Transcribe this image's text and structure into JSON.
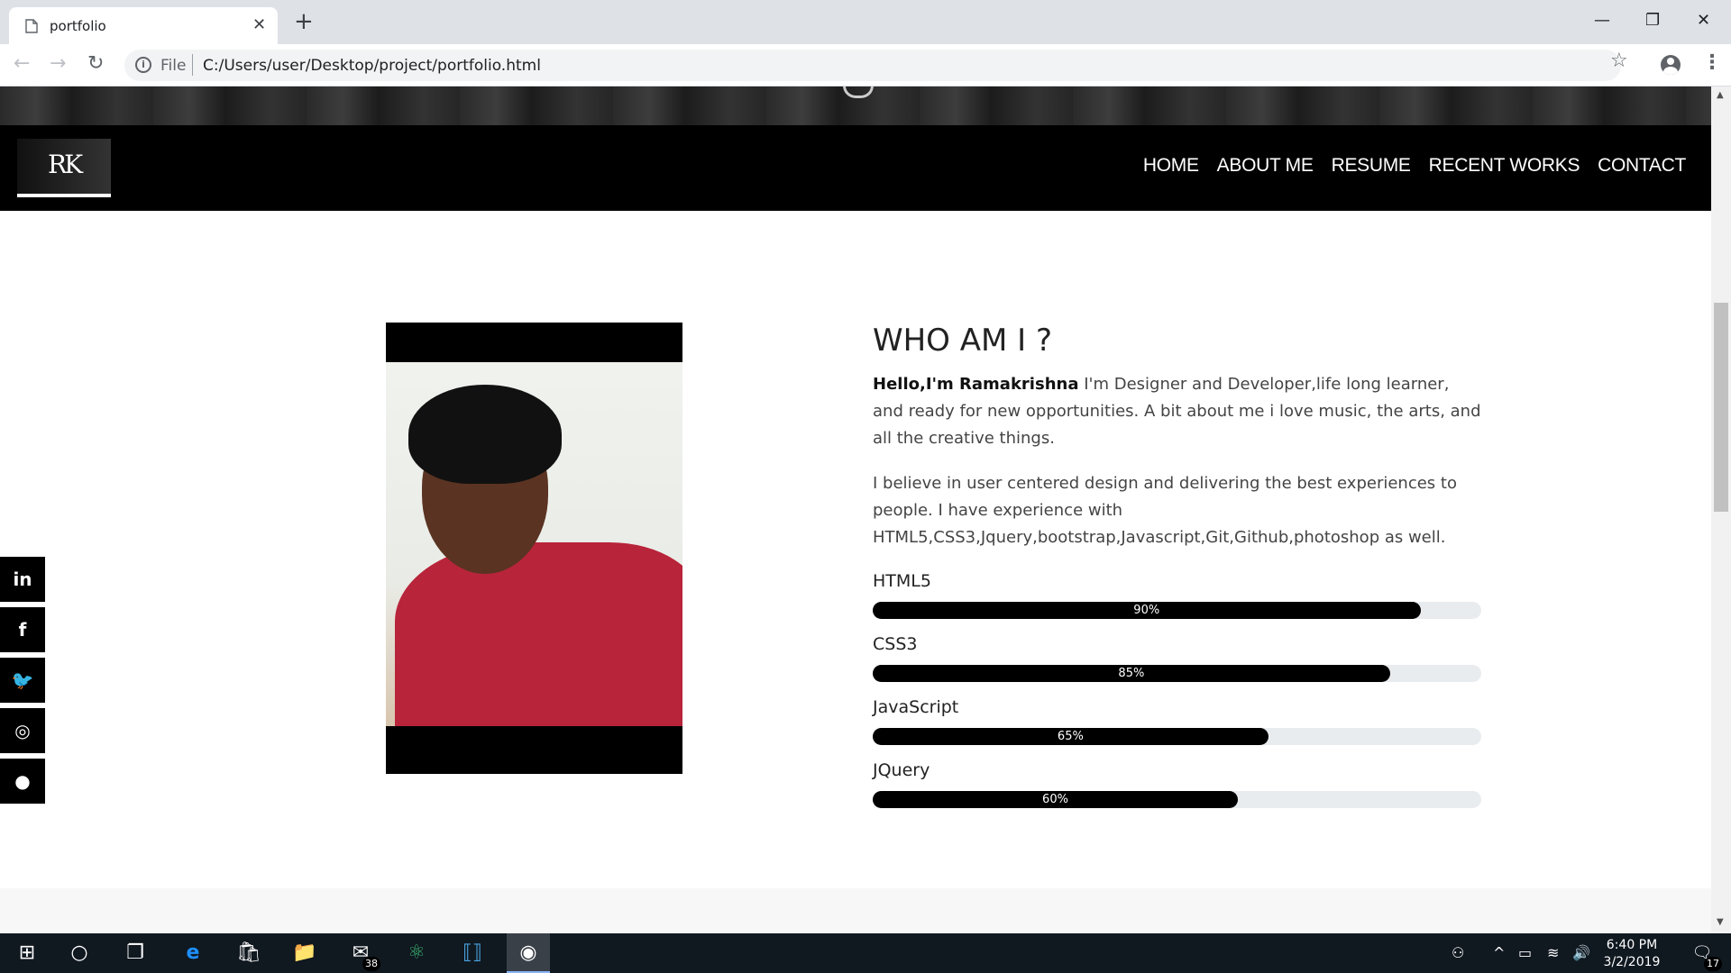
{
  "browser": {
    "tab_title": "portfolio",
    "tab_close": "✕",
    "new_tab": "+",
    "url_scheme": "File",
    "url": "C:/Users/user/Desktop/project/portfolio.html",
    "back": "←",
    "forward": "→",
    "reload": "↻",
    "star": "☆",
    "menu": "⋮",
    "minimize": "—",
    "maximize": "❐",
    "close": "✕"
  },
  "site": {
    "logo": "RK",
    "nav": [
      "HOME",
      "ABOUT ME",
      "RESUME",
      "RECENT WORKS",
      "CONTACT"
    ],
    "about": {
      "title": "WHO AM I ?",
      "intro_bold": "Hello,I'm Ramakrishna",
      "intro_rest": " I'm Designer and Developer,life long learner, and ready for new opportunities. A bit about me i love music, the arts, and all the creative things.",
      "paragraph2": "I believe in user centered design and delivering the best experiences to people. I have experience with HTML5,CSS3,Jquery,bootstrap,Javascript,Git,Github,photoshop as well."
    },
    "skills": [
      {
        "name": "HTML5",
        "percent": 90,
        "label": "90%"
      },
      {
        "name": "CSS3",
        "percent": 85,
        "label": "85%"
      },
      {
        "name": "JavaScript",
        "percent": 65,
        "label": "65%"
      },
      {
        "name": "JQuery",
        "percent": 60,
        "label": "60%"
      }
    ],
    "social": [
      {
        "name": "linkedin-icon",
        "glyph": "in"
      },
      {
        "name": "facebook-icon",
        "glyph": "f"
      },
      {
        "name": "twitter-icon",
        "glyph": "🐦"
      },
      {
        "name": "instagram-icon",
        "glyph": "◎"
      },
      {
        "name": "github-icon",
        "glyph": "●"
      }
    ]
  },
  "taskbar": {
    "mail_badge": "38",
    "notif_badge": "17",
    "time": "6:40 PM",
    "date": "3/2/2019"
  },
  "colors": {
    "nav_bg": "#000000",
    "skill_fill": "#000000",
    "skill_track": "#e9ecef",
    "taskbar": "#101820"
  }
}
